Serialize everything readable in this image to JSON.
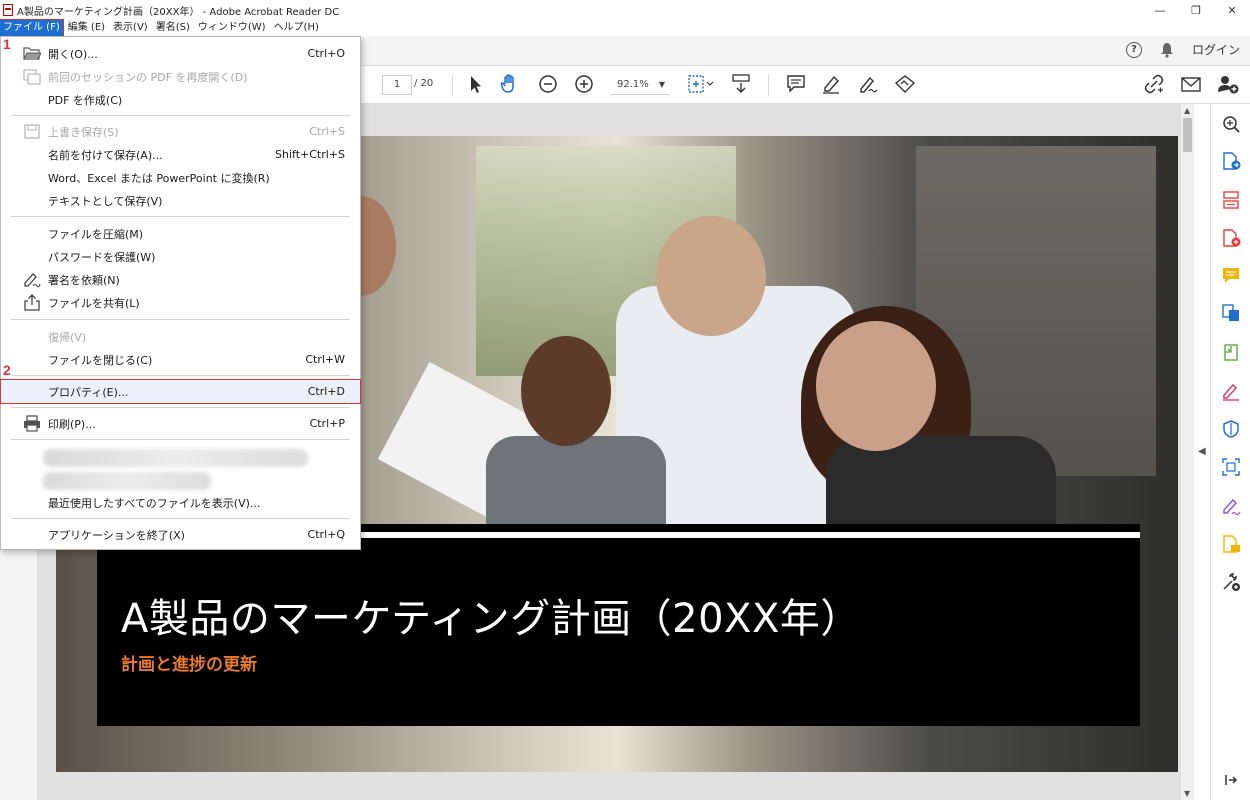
{
  "window": {
    "title": "A製品のマーケティング計画（20XX年） - Adobe Acrobat Reader DC",
    "minimize": "—",
    "restore": "❐",
    "close": "✕"
  },
  "menubar": {
    "items": [
      "ファイル (F)",
      "編集 (E)",
      "表示(V)",
      "署名(S)",
      "ウィンドウ(W)",
      "ヘルプ(H)"
    ]
  },
  "header": {
    "login": "ログイン"
  },
  "toolbar": {
    "page_current": "1",
    "page_total": "/ 20",
    "zoom": "92.1%"
  },
  "file_menu": {
    "items": [
      {
        "label": "開く(O)...",
        "shortcut": "Ctrl+O",
        "icon": "folder-open-icon",
        "disabled": false
      },
      {
        "label": "前回のセッションの PDF を再度開く(D)",
        "shortcut": "",
        "icon": "reopen-session-icon",
        "disabled": true
      },
      {
        "label": "PDF を作成(C)",
        "shortcut": "",
        "icon": "",
        "disabled": false
      },
      {
        "label": "上書き保存(S)",
        "shortcut": "Ctrl+S",
        "icon": "save-icon",
        "disabled": true
      },
      {
        "label": "名前を付けて保存(A)...",
        "shortcut": "Shift+Ctrl+S",
        "icon": "",
        "disabled": false
      },
      {
        "label": "Word、Excel または PowerPoint に変換(R)",
        "shortcut": "",
        "icon": "",
        "disabled": false
      },
      {
        "label": "テキストとして保存(V)",
        "shortcut": "",
        "icon": "",
        "disabled": false
      },
      {
        "label": "ファイルを圧縮(M)",
        "shortcut": "",
        "icon": "",
        "disabled": false
      },
      {
        "label": "パスワードを保護(W)",
        "shortcut": "",
        "icon": "",
        "disabled": false
      },
      {
        "label": "署名を依頼(N)",
        "shortcut": "",
        "icon": "request-signature-icon",
        "disabled": false
      },
      {
        "label": "ファイルを共有(L)",
        "shortcut": "",
        "icon": "share-icon",
        "disabled": false
      },
      {
        "label": "復帰(V)",
        "shortcut": "",
        "icon": "",
        "disabled": true
      },
      {
        "label": "ファイルを閉じる(C)",
        "shortcut": "Ctrl+W",
        "icon": "",
        "disabled": false
      },
      {
        "label": "プロパティ(E)...",
        "shortcut": "Ctrl+D",
        "icon": "",
        "disabled": false,
        "highlighted": true
      },
      {
        "label": "印刷(P)...",
        "shortcut": "Ctrl+P",
        "icon": "printer-icon",
        "disabled": false
      },
      {
        "label": "最近使用したすべてのファイルを表示(V)...",
        "shortcut": "",
        "icon": "",
        "disabled": false
      },
      {
        "label": "アプリケーションを終了(X)",
        "shortcut": "Ctrl+Q",
        "icon": "",
        "disabled": false
      }
    ]
  },
  "steps": {
    "one": "1",
    "two": "2"
  },
  "document": {
    "banner_title": "A製品のマーケティング計画（20XX年）",
    "banner_subtitle": "計画と進捗の更新"
  },
  "colors": {
    "menu_active": "#1f6fd0",
    "step_marker": "#d8333a",
    "banner_subtitle": "#e67a2e",
    "icon_blue": "#1f6fd0",
    "icon_red": "#e3413d",
    "icon_yellow": "#f2b600",
    "icon_green": "#5bab3c",
    "icon_purple": "#8b5bd6",
    "icon_pink": "#de3d6b"
  }
}
